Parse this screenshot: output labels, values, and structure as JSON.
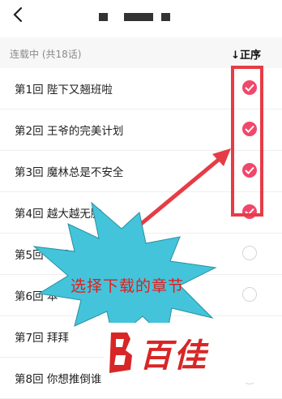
{
  "header": {
    "back_icon": "chevron-left-icon",
    "title_redacted": true
  },
  "subheader": {
    "status": "连载中 (共18话)",
    "sort_label": "↓正序"
  },
  "chapters": [
    {
      "title": "第1回 陛下又翘班啦",
      "selected": true
    },
    {
      "title": "第2回 王爷的完美计划",
      "selected": true
    },
    {
      "title": "第3回 魔林总是不安全",
      "selected": true
    },
    {
      "title": "第4回 越大越无脑",
      "selected": true
    },
    {
      "title": "第5回 误闯",
      "selected": false
    },
    {
      "title": "第6回 本",
      "selected": false
    },
    {
      "title": "第7回 拜拜",
      "selected": false
    },
    {
      "title": "第8回 你想推倒谁",
      "selected": false
    }
  ],
  "annotation": {
    "callout_text": "选择下载的章节",
    "highlight_color": "#e63c46",
    "starburst_color": "#43c4da"
  },
  "watermark": {
    "text": "百佳",
    "color": "#d82626"
  },
  "colors": {
    "accent": "#f0476a"
  }
}
